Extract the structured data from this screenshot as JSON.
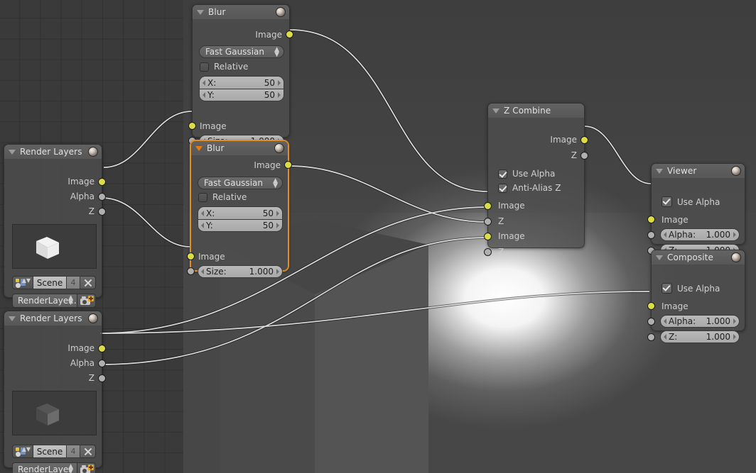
{
  "app": {
    "editor": "Blender Compositor Node Editor"
  },
  "colors": {
    "background": "#3a3a3a",
    "node_body": "#4e4e4e",
    "node_header": "#606060",
    "selected_outline": "#e88b20",
    "socket_image": "#dcdc46",
    "socket_value": "#b0b0b0",
    "noodle": "#d8d8d8"
  },
  "nodes": [
    {
      "id": "blur-top",
      "type": "Blur",
      "title": "Blur",
      "selected": false,
      "outputs": [
        {
          "label": "Image",
          "socket": "image"
        }
      ],
      "inputs": [
        {
          "label": "Image",
          "socket": "image"
        },
        {
          "label": "Size",
          "socket": "value"
        }
      ],
      "filter_type": "Fast Gaussian",
      "relative_label": "Relative",
      "relative_checked": false,
      "x_label": "X:",
      "x_value": "50",
      "y_label": "Y:",
      "y_value": "50",
      "size_label": "Size:",
      "size_value": "1.000"
    },
    {
      "id": "blur-bottom",
      "type": "Blur",
      "title": "Blur",
      "selected": true,
      "outputs": [
        {
          "label": "Image",
          "socket": "image"
        }
      ],
      "inputs": [
        {
          "label": "Image",
          "socket": "image"
        },
        {
          "label": "Size",
          "socket": "value"
        }
      ],
      "filter_type": "Fast Gaussian",
      "relative_label": "Relative",
      "relative_checked": false,
      "x_label": "X:",
      "x_value": "50",
      "y_label": "Y:",
      "y_value": "50",
      "size_label": "Size:",
      "size_value": "1.000"
    },
    {
      "id": "render-layers-top",
      "type": "Render Layers",
      "title": "Render Layers",
      "selected": false,
      "outputs": [
        {
          "label": "Image",
          "socket": "image"
        },
        {
          "label": "Alpha",
          "socket": "value"
        },
        {
          "label": "Z",
          "socket": "value"
        }
      ],
      "scene_name": "Scene",
      "scene_users": "4",
      "layer_name": "RenderLayer...."
    },
    {
      "id": "render-layers-bottom",
      "type": "Render Layers",
      "title": "Render Layers",
      "selected": false,
      "outputs": [
        {
          "label": "Image",
          "socket": "image"
        },
        {
          "label": "Alpha",
          "socket": "value"
        },
        {
          "label": "Z",
          "socket": "value"
        }
      ],
      "scene_name": "Scene",
      "scene_users": "4",
      "layer_name": "RenderLayer"
    },
    {
      "id": "z-combine",
      "type": "Z Combine",
      "title": "Z Combine",
      "selected": false,
      "outputs": [
        {
          "label": "Image",
          "socket": "image"
        },
        {
          "label": "Z",
          "socket": "value"
        }
      ],
      "use_alpha_label": "Use Alpha",
      "use_alpha_checked": true,
      "anti_alias_label": "Anti-Alias Z",
      "anti_alias_checked": true,
      "inputs": [
        {
          "label": "Image",
          "socket": "image"
        },
        {
          "label": "Z",
          "socket": "value"
        },
        {
          "label": "Image",
          "socket": "image"
        },
        {
          "label": "Z",
          "socket": "value"
        }
      ]
    },
    {
      "id": "viewer",
      "type": "Viewer",
      "title": "Viewer",
      "selected": false,
      "use_alpha_label": "Use Alpha",
      "use_alpha_checked": true,
      "image_label": "Image",
      "alpha_label": "Alpha:",
      "alpha_value": "1.000",
      "z_label": "Z:",
      "z_value": "1.000"
    },
    {
      "id": "composite",
      "type": "Composite",
      "title": "Composite",
      "selected": false,
      "use_alpha_label": "Use Alpha",
      "use_alpha_checked": true,
      "image_label": "Image",
      "alpha_label": "Alpha:",
      "alpha_value": "1.000",
      "z_label": "Z:",
      "z_value": "1.000"
    }
  ],
  "labels": {
    "image": "Image",
    "alpha": "Alpha",
    "z": "Z"
  }
}
